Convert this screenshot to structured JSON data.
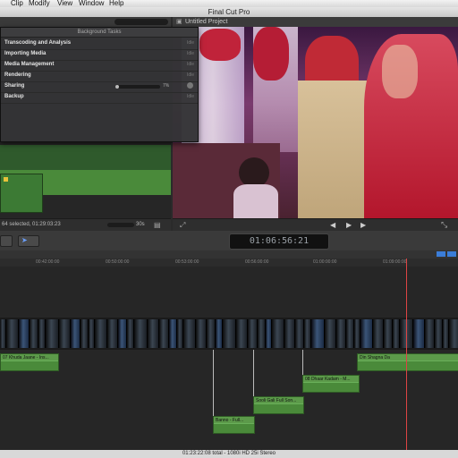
{
  "menubar": {
    "items": [
      "Clip",
      "Modify",
      "View",
      "Window",
      "Help"
    ]
  },
  "window": {
    "title": "Final Cut Pro"
  },
  "viewer": {
    "project_title": "Untitled Project"
  },
  "background_tasks": {
    "title": "Background Tasks",
    "tasks": [
      {
        "label": "Transcoding and Analysis",
        "status": "Idle"
      },
      {
        "label": "Importing Media",
        "status": "Idle"
      },
      {
        "label": "Media Management",
        "status": "Idle"
      },
      {
        "label": "Rendering",
        "status": "Idle"
      },
      {
        "label": "Sharing",
        "status": "7%",
        "progress": 0.07
      },
      {
        "label": "Backup",
        "status": "Idle"
      }
    ]
  },
  "browser": {
    "footer_text": "64 selected, 01:29:03:23",
    "zoom_label": "30s"
  },
  "toolbar": {
    "timecode": "01:06:56:21"
  },
  "ruler": {
    "labels": [
      "00:42:00:00",
      "00:50:00:00",
      "00:53:00:00",
      "00:56:00:00",
      "01:00:00:00",
      "01:09:00:00"
    ]
  },
  "timeline": {
    "clips": [
      {
        "label": "07 Khuda Jaane - Ins..."
      },
      {
        "label": "Din Shagna Da"
      },
      {
        "label": "08 Dhaar Kadam - M..."
      },
      {
        "label": "Sooli Gali Full Son..."
      },
      {
        "label": "Banno - Full..."
      }
    ]
  },
  "statusbar": {
    "text": "01:23:22:08 total - 1080i HD 25i Stereo"
  },
  "colors": {
    "clip_green": "#5c9a4a",
    "playhead": "#dd4444",
    "accent_blue": "#3b7dd8"
  }
}
